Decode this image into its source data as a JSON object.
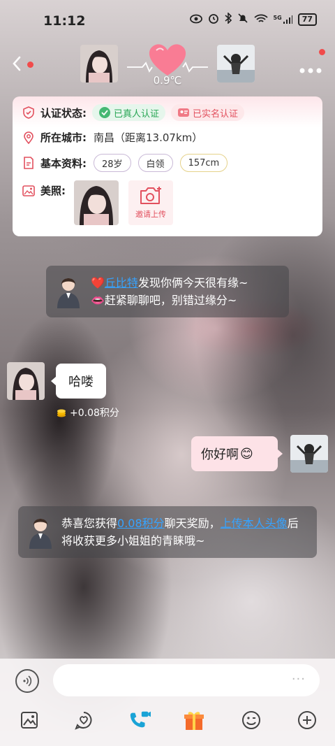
{
  "status_bar": {
    "time": "11:12",
    "network": "5G",
    "battery": "77"
  },
  "header": {
    "temperature": "0.9℃"
  },
  "profile_card": {
    "verification": {
      "label": "认证状态:",
      "badges": [
        "已真人认证",
        "已实名认证"
      ]
    },
    "city": {
      "label": "所在城市:",
      "value": "南昌（距离13.07km）"
    },
    "basic": {
      "label": "基本资料:",
      "tags": [
        "28岁",
        "白领",
        "157cm"
      ]
    },
    "photos": {
      "label": "美照:",
      "upload_label": "邀请上传"
    }
  },
  "system_message_1": {
    "heart": "❤️",
    "link": "丘比特",
    "text1": "发现你俩今天很有缘~",
    "lips": "👄",
    "text2": "赶紧聊聊吧，别错过缘分~"
  },
  "messages": {
    "incoming_text": "哈喽",
    "points_text": "+0.08积分",
    "outgoing_text": "你好啊",
    "outgoing_emoji": "😊"
  },
  "system_message_2": {
    "text1": "恭喜您获得",
    "link1": "0.08积分",
    "text2": "聊天奖励，",
    "link2": "上传本人头像",
    "text3": "后将收获更多小姐姐的青睐哦~"
  },
  "input": {
    "more_dots": "···"
  },
  "colors": {
    "accent_pink": "#e2505e",
    "link_blue": "#36a3ff",
    "verified_green": "#27a554",
    "video_call_blue": "#1aa3d6"
  }
}
